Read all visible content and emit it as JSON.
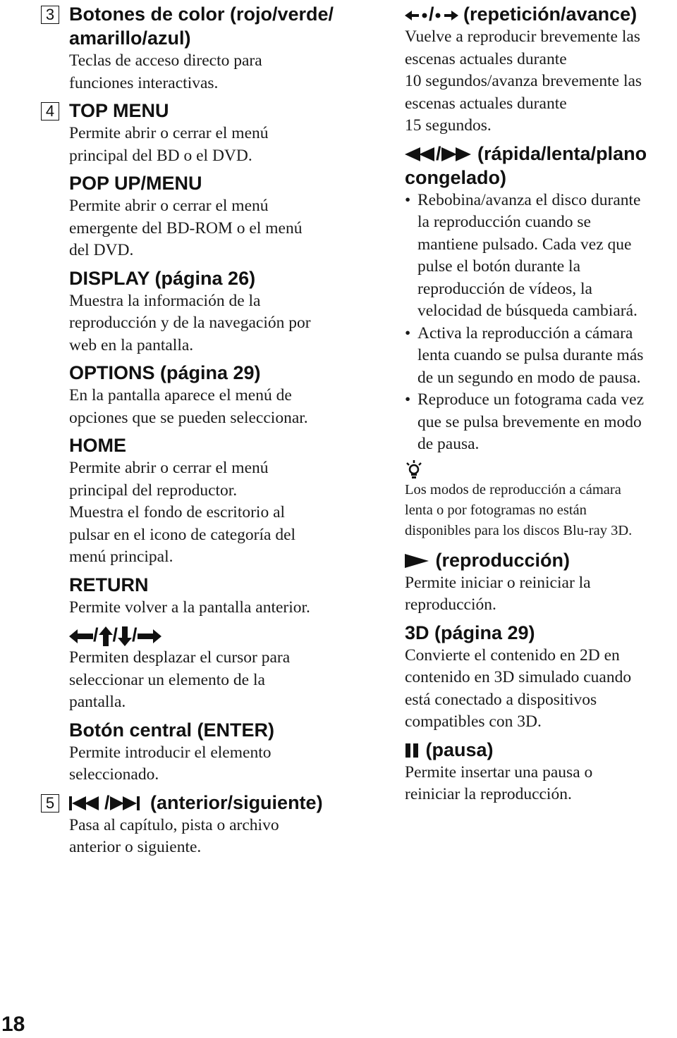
{
  "page_number": "18",
  "left": {
    "sec3": {
      "number": "3",
      "title_line1": "Botones de color (rojo/verde/",
      "title_line2": "amarillo/azul)",
      "desc_lines": [
        "Teclas de acceso directo para",
        "funciones interactivas."
      ]
    },
    "sec4": {
      "number": "4",
      "top_menu": {
        "title": "TOP MENU",
        "desc_lines": [
          "Permite abrir o cerrar el menú",
          "principal del BD o el DVD."
        ]
      },
      "popup_menu": {
        "title": "POP UP/MENU",
        "desc_lines": [
          "Permite abrir o cerrar el menú",
          "emergente del BD-ROM o el menú",
          "del DVD."
        ]
      },
      "display": {
        "title": "DISPLAY (página 26)",
        "desc_lines": [
          "Muestra la información de la",
          "reproducción y de la navegación por",
          "web en la pantalla."
        ]
      },
      "options": {
        "title": "OPTIONS (página 29)",
        "desc_lines": [
          "En la pantalla aparece el menú de",
          "opciones que se pueden seleccionar."
        ]
      },
      "home": {
        "title": "HOME",
        "desc_lines": [
          "Permite abrir o cerrar el menú",
          "principal del reproductor.",
          "Muestra el fondo de escritorio al",
          "pulsar en el icono de categoría del",
          "menú principal."
        ]
      },
      "return": {
        "title": "RETURN",
        "desc_lines": [
          "Permite volver a la pantalla anterior."
        ]
      },
      "arrows": {
        "icons": [
          "arrow-left",
          "arrow-up",
          "arrow-down",
          "arrow-right"
        ],
        "separator": "/",
        "desc_lines": [
          "Permiten desplazar el cursor para",
          "seleccionar un elemento de la",
          "pantalla."
        ]
      },
      "enter": {
        "title": "Botón central (ENTER)",
        "desc_lines": [
          "Permite introducir el elemento",
          "seleccionado."
        ]
      }
    },
    "sec5": {
      "number": "5",
      "icons": [
        "prev-track",
        "next-track"
      ],
      "separator": "/",
      "title": "(anterior/siguiente)",
      "desc_lines": [
        "Pasa al capítulo, pista o archivo",
        "anterior o siguiente."
      ]
    }
  },
  "right": {
    "replay": {
      "icons": [
        "instant-replay",
        "instant-advance"
      ],
      "separator": "/",
      "title": "(repetición/avance)",
      "desc_lines": [
        "Vuelve a reproducir brevemente las",
        "escenas actuales durante",
        "10 segundos/avanza brevemente las",
        "escenas actuales durante",
        "15 segundos."
      ]
    },
    "scan": {
      "icons": [
        "rewind",
        "fast-forward"
      ],
      "separator": "/",
      "title_line1": "(rápida/lenta/plano",
      "title_line2": "congelado)",
      "bullets": [
        [
          "Rebobina/avanza el disco durante",
          "la reproducción cuando se",
          "mantiene pulsado. Cada vez que",
          "pulse el botón durante la",
          "reproducción de vídeos, la",
          "velocidad de búsqueda cambiará."
        ],
        [
          "Activa la reproducción a cámara",
          "lenta cuando se pulsa durante más",
          "de un segundo en modo de pausa."
        ],
        [
          "Reproduce un fotograma cada vez",
          "que se pulsa brevemente en modo",
          "de pausa."
        ]
      ]
    },
    "tip": {
      "icon": "lightbulb-hint",
      "lines": [
        "Los modos de reproducción a cámara",
        "lenta o por fotogramas no están",
        "disponibles para los discos Blu-ray 3D."
      ]
    },
    "play": {
      "icon": "play",
      "title": "(reproducción)",
      "desc_lines": [
        "Permite iniciar o reiniciar la",
        "reproducción."
      ]
    },
    "threed": {
      "title": "3D (página 29)",
      "desc_lines": [
        "Convierte el contenido en 2D en",
        "contenido en 3D simulado cuando",
        "está conectado a dispositivos",
        "compatibles con 3D."
      ]
    },
    "pause": {
      "icon": "pause",
      "title": "(pausa)",
      "desc_lines": [
        "Permite insertar una pausa o",
        "reiniciar la reproducción."
      ]
    }
  }
}
